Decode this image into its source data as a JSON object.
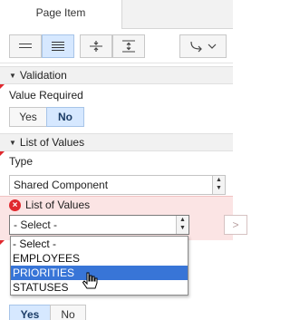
{
  "tabs": [
    {
      "label": "Page Item"
    }
  ],
  "toolbar": {
    "icons": [
      "rows-icon",
      "rows-dense-icon",
      "collapse-icon",
      "expand-icon",
      "goto-icon"
    ]
  },
  "validation": {
    "header": "Validation",
    "value_required_label": "Value Required",
    "yes": "Yes",
    "no": "No",
    "selected": "No"
  },
  "lov_section": {
    "header": "List of Values",
    "type_label": "Type",
    "type_value": "Shared Component"
  },
  "lov_field": {
    "label": "List of Values",
    "value": "- Select -",
    "error_icon": "error-icon",
    "next_glyph": ">"
  },
  "dropdown": {
    "options": [
      "- Select -",
      "EMPLOYEES",
      "PRIORITIES",
      "STATUSES"
    ],
    "highlighted": "PRIORITIES"
  },
  "bottom_toggle": {
    "yes": "Yes",
    "no": "No",
    "selected": "Yes"
  },
  "colors": {
    "accent": "#d6e8ff",
    "highlight": "#3875d7",
    "error": "#e0282e",
    "error_band": "#fbe4e4"
  }
}
